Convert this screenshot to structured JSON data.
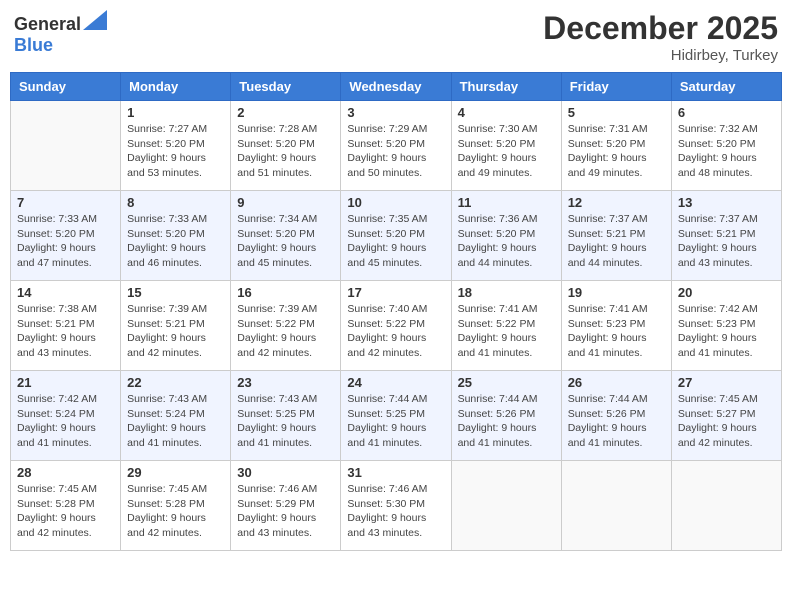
{
  "header": {
    "logo_general": "General",
    "logo_blue": "Blue",
    "month": "December 2025",
    "location": "Hidirbey, Turkey"
  },
  "days_of_week": [
    "Sunday",
    "Monday",
    "Tuesday",
    "Wednesday",
    "Thursday",
    "Friday",
    "Saturday"
  ],
  "weeks": [
    {
      "alt": false,
      "days": [
        {
          "num": "",
          "empty": true
        },
        {
          "num": "1",
          "sunrise": "7:27 AM",
          "sunset": "5:20 PM",
          "daylight": "9 hours and 53 minutes."
        },
        {
          "num": "2",
          "sunrise": "7:28 AM",
          "sunset": "5:20 PM",
          "daylight": "9 hours and 51 minutes."
        },
        {
          "num": "3",
          "sunrise": "7:29 AM",
          "sunset": "5:20 PM",
          "daylight": "9 hours and 50 minutes."
        },
        {
          "num": "4",
          "sunrise": "7:30 AM",
          "sunset": "5:20 PM",
          "daylight": "9 hours and 49 minutes."
        },
        {
          "num": "5",
          "sunrise": "7:31 AM",
          "sunset": "5:20 PM",
          "daylight": "9 hours and 49 minutes."
        },
        {
          "num": "6",
          "sunrise": "7:32 AM",
          "sunset": "5:20 PM",
          "daylight": "9 hours and 48 minutes."
        }
      ]
    },
    {
      "alt": true,
      "days": [
        {
          "num": "7",
          "sunrise": "7:33 AM",
          "sunset": "5:20 PM",
          "daylight": "9 hours and 47 minutes."
        },
        {
          "num": "8",
          "sunrise": "7:33 AM",
          "sunset": "5:20 PM",
          "daylight": "9 hours and 46 minutes."
        },
        {
          "num": "9",
          "sunrise": "7:34 AM",
          "sunset": "5:20 PM",
          "daylight": "9 hours and 45 minutes."
        },
        {
          "num": "10",
          "sunrise": "7:35 AM",
          "sunset": "5:20 PM",
          "daylight": "9 hours and 45 minutes."
        },
        {
          "num": "11",
          "sunrise": "7:36 AM",
          "sunset": "5:20 PM",
          "daylight": "9 hours and 44 minutes."
        },
        {
          "num": "12",
          "sunrise": "7:37 AM",
          "sunset": "5:21 PM",
          "daylight": "9 hours and 44 minutes."
        },
        {
          "num": "13",
          "sunrise": "7:37 AM",
          "sunset": "5:21 PM",
          "daylight": "9 hours and 43 minutes."
        }
      ]
    },
    {
      "alt": false,
      "days": [
        {
          "num": "14",
          "sunrise": "7:38 AM",
          "sunset": "5:21 PM",
          "daylight": "9 hours and 43 minutes."
        },
        {
          "num": "15",
          "sunrise": "7:39 AM",
          "sunset": "5:21 PM",
          "daylight": "9 hours and 42 minutes."
        },
        {
          "num": "16",
          "sunrise": "7:39 AM",
          "sunset": "5:22 PM",
          "daylight": "9 hours and 42 minutes."
        },
        {
          "num": "17",
          "sunrise": "7:40 AM",
          "sunset": "5:22 PM",
          "daylight": "9 hours and 42 minutes."
        },
        {
          "num": "18",
          "sunrise": "7:41 AM",
          "sunset": "5:22 PM",
          "daylight": "9 hours and 41 minutes."
        },
        {
          "num": "19",
          "sunrise": "7:41 AM",
          "sunset": "5:23 PM",
          "daylight": "9 hours and 41 minutes."
        },
        {
          "num": "20",
          "sunrise": "7:42 AM",
          "sunset": "5:23 PM",
          "daylight": "9 hours and 41 minutes."
        }
      ]
    },
    {
      "alt": true,
      "days": [
        {
          "num": "21",
          "sunrise": "7:42 AM",
          "sunset": "5:24 PM",
          "daylight": "9 hours and 41 minutes."
        },
        {
          "num": "22",
          "sunrise": "7:43 AM",
          "sunset": "5:24 PM",
          "daylight": "9 hours and 41 minutes."
        },
        {
          "num": "23",
          "sunrise": "7:43 AM",
          "sunset": "5:25 PM",
          "daylight": "9 hours and 41 minutes."
        },
        {
          "num": "24",
          "sunrise": "7:44 AM",
          "sunset": "5:25 PM",
          "daylight": "9 hours and 41 minutes."
        },
        {
          "num": "25",
          "sunrise": "7:44 AM",
          "sunset": "5:26 PM",
          "daylight": "9 hours and 41 minutes."
        },
        {
          "num": "26",
          "sunrise": "7:44 AM",
          "sunset": "5:26 PM",
          "daylight": "9 hours and 41 minutes."
        },
        {
          "num": "27",
          "sunrise": "7:45 AM",
          "sunset": "5:27 PM",
          "daylight": "9 hours and 42 minutes."
        }
      ]
    },
    {
      "alt": false,
      "days": [
        {
          "num": "28",
          "sunrise": "7:45 AM",
          "sunset": "5:28 PM",
          "daylight": "9 hours and 42 minutes."
        },
        {
          "num": "29",
          "sunrise": "7:45 AM",
          "sunset": "5:28 PM",
          "daylight": "9 hours and 42 minutes."
        },
        {
          "num": "30",
          "sunrise": "7:46 AM",
          "sunset": "5:29 PM",
          "daylight": "9 hours and 43 minutes."
        },
        {
          "num": "31",
          "sunrise": "7:46 AM",
          "sunset": "5:30 PM",
          "daylight": "9 hours and 43 minutes."
        },
        {
          "num": "",
          "empty": true
        },
        {
          "num": "",
          "empty": true
        },
        {
          "num": "",
          "empty": true
        }
      ]
    }
  ]
}
